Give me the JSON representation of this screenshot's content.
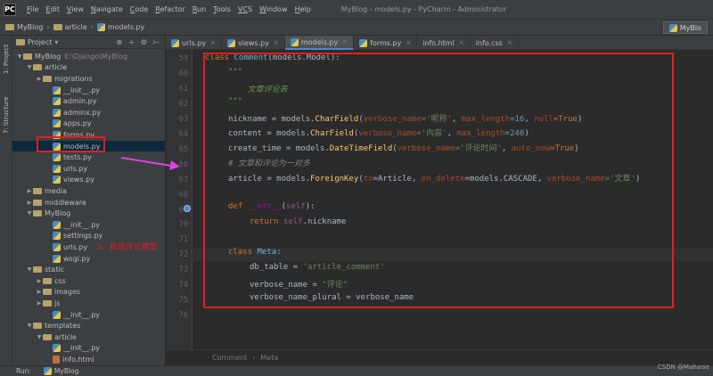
{
  "menubar": {
    "logo": "PC",
    "items": [
      {
        "u": "F",
        "rest": "ile"
      },
      {
        "u": "E",
        "rest": "dit"
      },
      {
        "u": "V",
        "rest": "iew"
      },
      {
        "u": "N",
        "rest": "avigate"
      },
      {
        "u": "C",
        "rest": "ode"
      },
      {
        "u": "R",
        "rest": "efactor"
      },
      {
        "u": "R",
        "rest": "un"
      },
      {
        "u": "T",
        "rest": "ools"
      },
      {
        "u": "VC",
        "rest": "S"
      },
      {
        "u": "W",
        "rest": "indow"
      },
      {
        "u": "H",
        "rest": "elp"
      }
    ],
    "window_title": "MyBlog - models.py - PyCharm - Administrator"
  },
  "breadcrumb": {
    "project": "MyBlog",
    "folder": "article",
    "file": "models.py",
    "run_config": "MyBlo"
  },
  "left_tools": {
    "project_tab": "1: Project",
    "structure_tab": "7: Structure"
  },
  "project_panel": {
    "title": "Project",
    "tree": [
      {
        "depth": 0,
        "type": "folder",
        "open": true,
        "label": "MyBlog",
        "hint": "E:\\Django\\MyBlog"
      },
      {
        "depth": 1,
        "type": "folder",
        "open": true,
        "label": "article"
      },
      {
        "depth": 2,
        "type": "folder",
        "open": false,
        "label": "migrations"
      },
      {
        "depth": 3,
        "type": "py",
        "label": "__init__.py"
      },
      {
        "depth": 3,
        "type": "py",
        "label": "admin.py"
      },
      {
        "depth": 3,
        "type": "py",
        "label": "adminx.py"
      },
      {
        "depth": 3,
        "type": "py",
        "label": "apps.py"
      },
      {
        "depth": 3,
        "type": "py",
        "label": "forms.py"
      },
      {
        "depth": 3,
        "type": "py",
        "label": "models.py",
        "selected": true
      },
      {
        "depth": 3,
        "type": "py",
        "label": "tests.py"
      },
      {
        "depth": 3,
        "type": "py",
        "label": "urls.py"
      },
      {
        "depth": 3,
        "type": "py",
        "label": "views.py"
      },
      {
        "depth": 1,
        "type": "folder",
        "open": false,
        "label": "media"
      },
      {
        "depth": 1,
        "type": "folder",
        "open": false,
        "label": "middleware"
      },
      {
        "depth": 1,
        "type": "folder",
        "open": true,
        "label": "MyBlog"
      },
      {
        "depth": 3,
        "type": "py",
        "label": "__init__.py"
      },
      {
        "depth": 3,
        "type": "py",
        "label": "settings.py"
      },
      {
        "depth": 3,
        "type": "py",
        "label": "urls.py"
      },
      {
        "depth": 3,
        "type": "py",
        "label": "wsgi.py"
      },
      {
        "depth": 1,
        "type": "folder",
        "open": true,
        "label": "static"
      },
      {
        "depth": 2,
        "type": "folder",
        "open": false,
        "label": "css"
      },
      {
        "depth": 2,
        "type": "folder",
        "open": false,
        "label": "images"
      },
      {
        "depth": 2,
        "type": "folder",
        "open": false,
        "label": "js"
      },
      {
        "depth": 3,
        "type": "py",
        "label": "__init__.py"
      },
      {
        "depth": 1,
        "type": "folder",
        "open": true,
        "label": "templates"
      },
      {
        "depth": 2,
        "type": "folder",
        "open": true,
        "label": "article"
      },
      {
        "depth": 3,
        "type": "py",
        "label": "__init__.py"
      },
      {
        "depth": 3,
        "type": "html",
        "label": "info.html"
      }
    ]
  },
  "tabs": [
    {
      "label": "urls.py",
      "active": false
    },
    {
      "label": "views.py",
      "active": false
    },
    {
      "label": "models.py",
      "active": true
    },
    {
      "label": "forms.py",
      "active": false
    },
    {
      "label": "info.html",
      "active": false
    },
    {
      "label": "info.css",
      "active": false
    }
  ],
  "editor": {
    "line_numbers": [
      "59",
      "60",
      "61",
      "62",
      "63",
      "64",
      "65",
      "66",
      "67",
      "68",
      "69",
      "70",
      "71",
      "72",
      "73",
      "74",
      "75",
      "76"
    ],
    "code": {
      "l59_kw": "class ",
      "l59_name": "Comment",
      "l59_rest": "(models.Model):",
      "l60": "\"\"\"",
      "l61": "    文章评论表",
      "l62": "\"\"\"",
      "l63_a": "nickname = models.",
      "l63_fn": "CharField",
      "l63_b": "(",
      "l63_k1": "verbose_name",
      "l63_s1": "='昵称'",
      "l63_c1": ", ",
      "l63_k2": "max_length",
      "l63_n1": "=16",
      "l63_c2": ", ",
      "l63_k3": "null",
      "l63_v3": "=True",
      "l63_e": ")",
      "l64_a": "content = models.",
      "l64_fn": "CharField",
      "l64_b": "(",
      "l64_k1": "verbose_name",
      "l64_s1": "='内容'",
      "l64_c1": ", ",
      "l64_k2": "max_length",
      "l64_n1": "=240",
      "l64_e": ")",
      "l65_a": "create_time = models.",
      "l65_fn": "DateTimeField",
      "l65_b": "(",
      "l65_k1": "verbose_name",
      "l65_s1": "='评论时间'",
      "l65_c1": ", ",
      "l65_k2": "auto_now",
      "l65_v2": "=True",
      "l65_e": ")",
      "l66": "# 文章和评论为一对多",
      "l67_a": "article = models.",
      "l67_fn": "ForeignKey",
      "l67_b": "(",
      "l67_k1": "to",
      "l67_v1": "=Article, ",
      "l67_k2": "on_delete",
      "l67_v2": "=models.CASCADE, ",
      "l67_k3": "verbose_name",
      "l67_s3": "='文章'",
      "l67_e": ")",
      "l69_kw": "def ",
      "l69_fn": "__str__",
      "l69_b": "(",
      "l69_self": "self",
      "l69_e": "):",
      "l70_kw": "return ",
      "l70_self": "self",
      "l70_e": ".nickname",
      "l72_kw": "class ",
      "l72_name": "Meta",
      "l72_e": ":",
      "l73_a": "db_table = ",
      "l73_s": "'article_comment'",
      "l74_a": "verbose_name = ",
      "l74_s": "\"评论\"",
      "l75_a": "verbose_name_plural = verbose_name"
    }
  },
  "annotation": "3、新增评论模型",
  "editor_footer": {
    "crumb1": "Comment",
    "crumb2": "Meta"
  },
  "bottombar": {
    "run": "Run:",
    "config": "MyBlog"
  },
  "watermark": "CSDN @Mahaise"
}
